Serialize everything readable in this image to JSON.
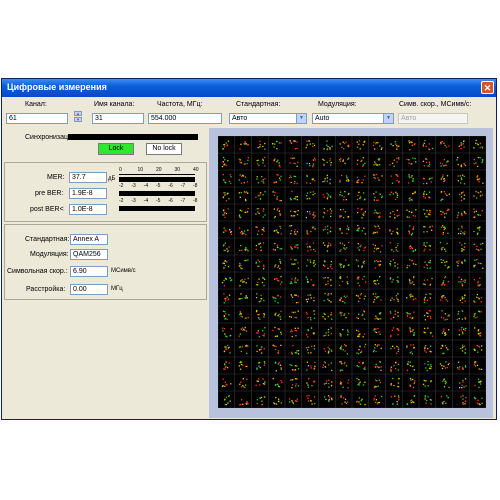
{
  "window": {
    "title": "Цифровые измерения",
    "close_glyph": "✕"
  },
  "top": {
    "channel": {
      "label": "Канал:",
      "value": "61"
    },
    "channel_name": {
      "label": "Имя канала:",
      "value": "31"
    },
    "frequency": {
      "label": "Частота,  МГц:",
      "value": "554.000"
    },
    "standard": {
      "label": "Стандартная:",
      "value": "Авто"
    },
    "modulation": {
      "label": "Модуляция:",
      "value": "Auto"
    },
    "symbol_rate": {
      "label": "Симв. скор., МСимв/с:",
      "value": "Авто"
    }
  },
  "sync": {
    "label": "Синхронизация",
    "lock_label": "Lock",
    "nolock_label": "No lock",
    "lock_color": "#2ee82e"
  },
  "measurements": {
    "mer": {
      "label": "MER:",
      "value": "37.7",
      "unit": "дБ"
    },
    "pre_ber": {
      "label": "pre BER:",
      "value": "1.9E-8"
    },
    "post_ber": {
      "label": "post BER<",
      "value": "1.0E-8"
    },
    "mer_scale": [
      "0",
      "10",
      "20",
      "30",
      "40"
    ],
    "ber_scale": [
      "-2",
      "-3",
      "-4",
      "-5",
      "-6",
      "-7",
      "-8"
    ]
  },
  "params": {
    "standard": {
      "label": "Стандартная:",
      "value": "Annex A"
    },
    "modulation": {
      "label": "Модуляция:",
      "value": "QAM256"
    },
    "symbol_rate": {
      "label": "Символьная скор.:",
      "value": "6.90",
      "unit": "МСимв/с"
    },
    "detuning": {
      "label": "Расстройка:",
      "value": "0.00",
      "unit": "МГц"
    }
  },
  "constellation": {
    "grid_size": 16,
    "background": "#000000",
    "grid_color": "#3a3a3a",
    "dot_colors": [
      "#ff3a1e",
      "#f0c800",
      "#3ad23a"
    ]
  }
}
